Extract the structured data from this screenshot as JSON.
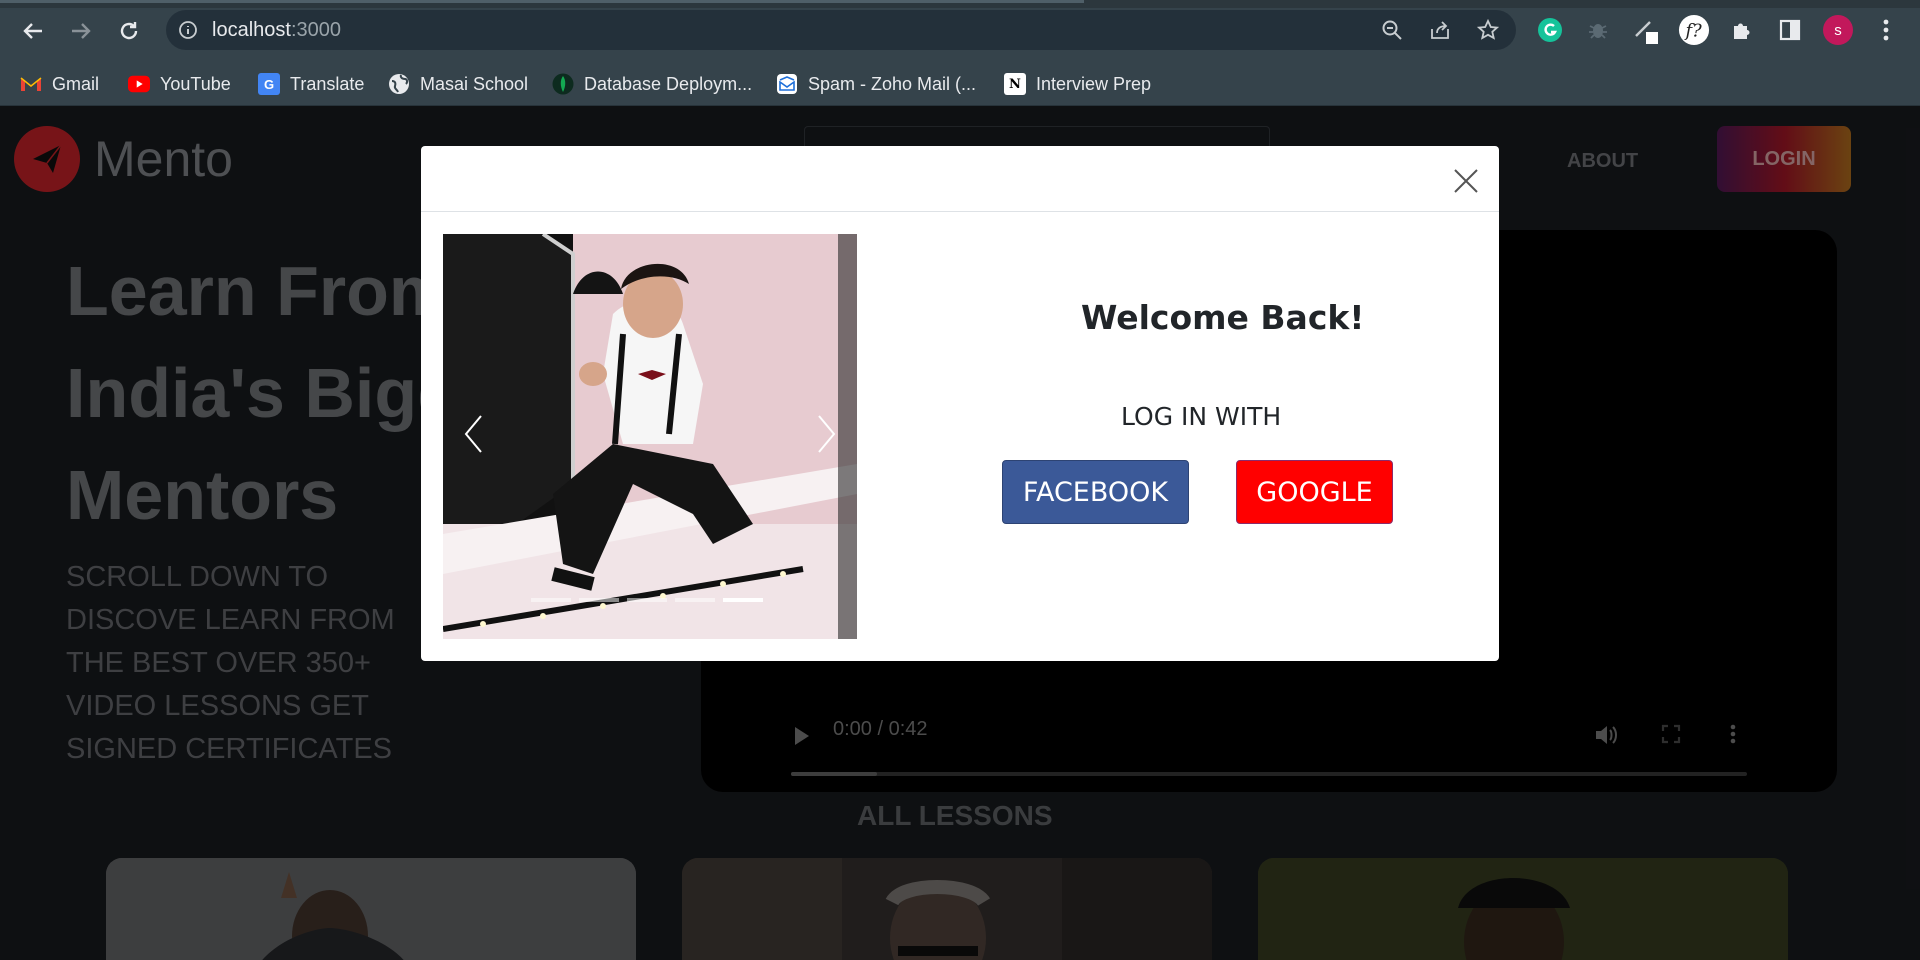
{
  "browser": {
    "url_host": "localhost",
    "url_port": ":3000",
    "bookmarks": [
      {
        "label": "Gmail",
        "icon": "gmail-icon"
      },
      {
        "label": "YouTube",
        "icon": "youtube-icon"
      },
      {
        "label": "Translate",
        "icon": "translate-icon"
      },
      {
        "label": "Masai School",
        "icon": "globe-icon"
      },
      {
        "label": "Database Deploym...",
        "icon": "mongodb-icon"
      },
      {
        "label": "Spam - Zoho Mail (...",
        "icon": "zoho-mail-icon"
      },
      {
        "label": "Interview Prep",
        "icon": "notion-icon"
      }
    ],
    "profile_initial": "S"
  },
  "page": {
    "brand": "Mento",
    "nav": {
      "about": "ABOUT",
      "login": "LOGIN"
    },
    "hero_title_lines": [
      "Learn From",
      "India's Bigg",
      "Mentors"
    ],
    "hero_sub_lines": [
      "SCROLL DOWN TO",
      "DISCOVE LEARN FROM",
      "THE BEST OVER 350+",
      "VIDEO LESSONS GET",
      "SIGNED CERTIFICATES"
    ],
    "video": {
      "time": "0:00 / 0:42",
      "progress": 0.09
    },
    "section_title": "ALL LESSONS"
  },
  "modal": {
    "title": "Welcome Back!",
    "login_with": "LOG IN WITH",
    "facebook": "FACEBOOK",
    "google": "GOOGLE",
    "carousel_slides": 5,
    "carousel_active": 4
  },
  "colors": {
    "facebook": "#3b5998",
    "google": "#ff0000",
    "brand_red": "#d9262c"
  }
}
